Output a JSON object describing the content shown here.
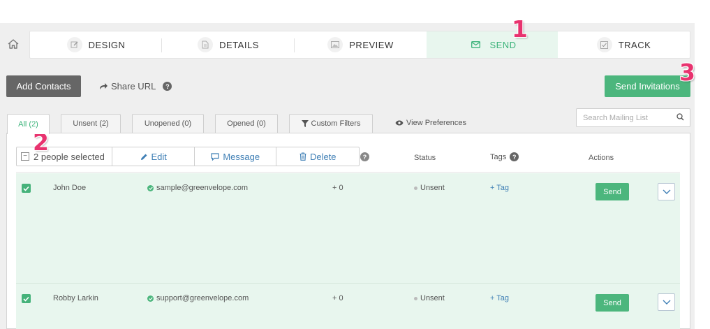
{
  "steps": [
    {
      "label": "DESIGN",
      "icon": "pencil-icon"
    },
    {
      "label": "DETAILS",
      "icon": "document-icon"
    },
    {
      "label": "PREVIEW",
      "icon": "image-icon"
    },
    {
      "label": "SEND",
      "icon": "envelope-icon",
      "active": true
    },
    {
      "label": "TRACK",
      "icon": "checkbox-icon"
    }
  ],
  "annotations": {
    "one": "1",
    "two": "2",
    "three": "3"
  },
  "toolbar": {
    "add_contacts": "Add Contacts",
    "share_url": "Share URL",
    "send_invitations": "Send Invitations"
  },
  "tabs": [
    {
      "label": "All (2)",
      "active": true
    },
    {
      "label": "Unsent (2)"
    },
    {
      "label": "Unopened (0)"
    },
    {
      "label": "Opened (0)"
    },
    {
      "label": "Custom Filters"
    }
  ],
  "view_preferences": "View Preferences",
  "search": {
    "placeholder": "Search Mailing List"
  },
  "bulk": {
    "selected": "2 people selected",
    "edit": "Edit",
    "message": "Message",
    "delete": "Delete"
  },
  "columns": {
    "status": "Status",
    "tags": "Tags",
    "actions": "Actions"
  },
  "rows": [
    {
      "name": "John Doe",
      "email": "sample@greenvelope.com",
      "guests": "+ 0",
      "status": "Unsent",
      "tag": "+ Tag",
      "send": "Send"
    },
    {
      "name": "Robby Larkin",
      "email": "support@greenvelope.com",
      "guests": "+ 0",
      "status": "Unsent",
      "tag": "+ Tag",
      "send": "Send"
    }
  ],
  "colors": {
    "accent_green": "#4cb67d",
    "active_tab_bg": "#e8f6ee",
    "link_blue": "#3f7fb5",
    "annotation_pink": "#e8336f"
  }
}
